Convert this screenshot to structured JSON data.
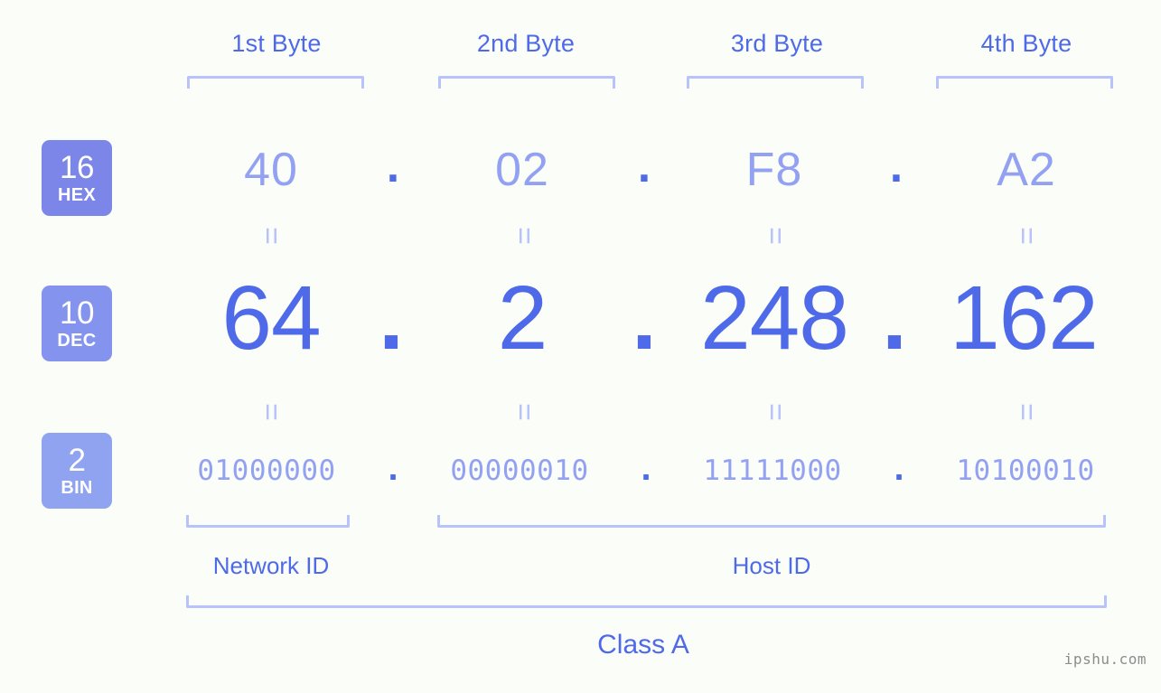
{
  "meta": {
    "background_color": "#fbfdf8",
    "accent_color": "#4f6ae8",
    "light_accent_color": "#93a1f2",
    "bracket_color": "#b9c3fb"
  },
  "byte_headers": [
    {
      "label": "1st Byte"
    },
    {
      "label": "2nd Byte"
    },
    {
      "label": "3rd Byte"
    },
    {
      "label": "4th Byte"
    }
  ],
  "bases": [
    {
      "num": "16",
      "label": "HEX",
      "color": "#7b86e8"
    },
    {
      "num": "10",
      "label": "DEC",
      "color": "#8494ee"
    },
    {
      "num": "2",
      "label": "BIN",
      "color": "#8fa3f0"
    }
  ],
  "rows": {
    "hex": {
      "values": [
        "40",
        "02",
        "F8",
        "A2"
      ],
      "separator": "."
    },
    "dec": {
      "values": [
        "64",
        "2",
        "248",
        "162"
      ],
      "separator": "."
    },
    "bin": {
      "values": [
        "01000000",
        "00000010",
        "11111000",
        "10100010"
      ],
      "separator": "."
    }
  },
  "equals_symbol": "=",
  "sections": [
    {
      "label": "Network ID"
    },
    {
      "label": "Host ID"
    }
  ],
  "class": {
    "label": "Class A"
  },
  "watermark": {
    "text": "ipshu.com"
  }
}
